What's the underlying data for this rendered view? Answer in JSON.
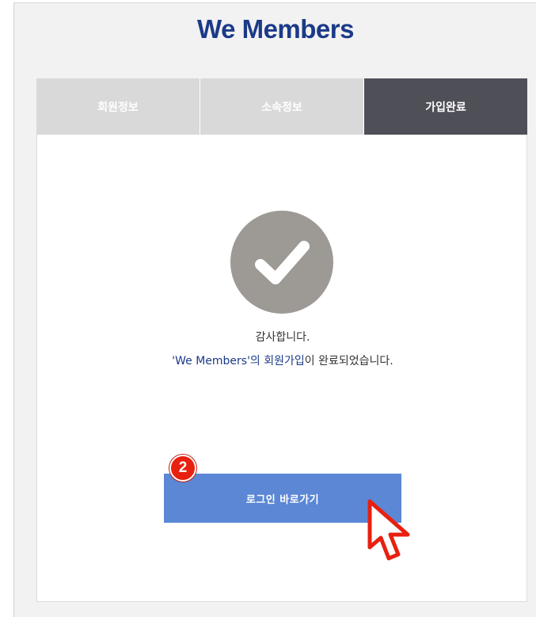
{
  "brand": {
    "title": "We Members"
  },
  "steps": {
    "items": [
      {
        "label": "회원정보",
        "active": false
      },
      {
        "label": "소속정보",
        "active": false
      },
      {
        "label": "가입완료",
        "active": true
      }
    ]
  },
  "completion": {
    "line1": "감사합니다.",
    "line2_part1": "'We Members'의 회원가입",
    "line2_part2": "이 완료되었습니다."
  },
  "actions": {
    "login_label": "로그인 바로가기"
  },
  "annotation": {
    "step_number": "2"
  },
  "colors": {
    "brand": "#1b3a88",
    "tab_inactive": "#d9d9d9",
    "tab_active": "#4f5057",
    "check_circle": "#9d9995",
    "button": "#5b87d5",
    "badge": "#e8200f",
    "cursor_outline": "#e8200f"
  },
  "icons": {
    "status": "check-icon",
    "pointer": "hand-pointer-icon"
  }
}
